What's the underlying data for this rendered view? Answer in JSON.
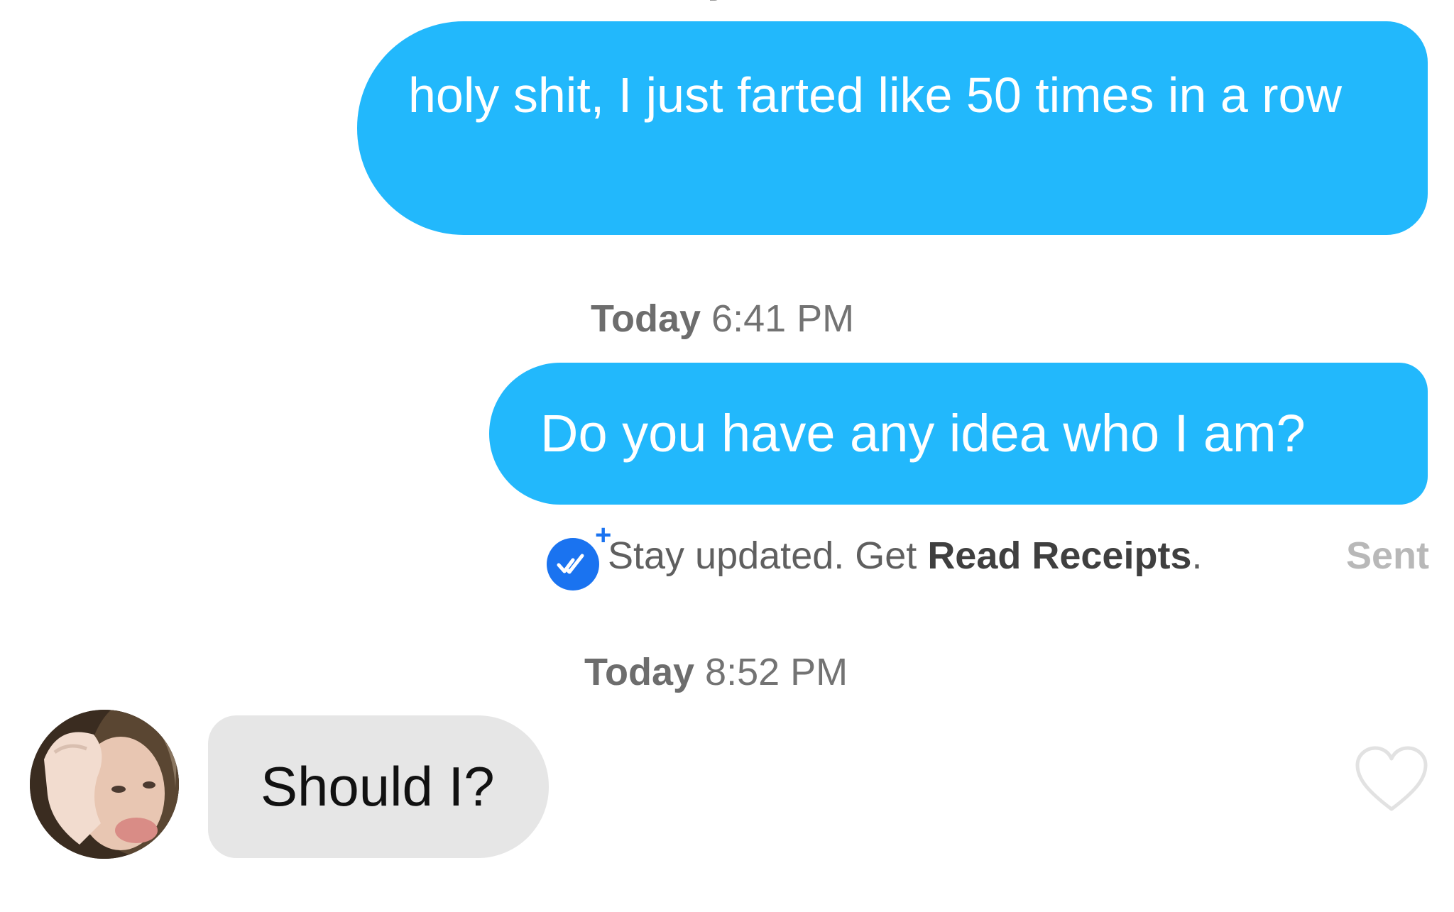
{
  "conversation": {
    "messages": [
      {
        "direction": "outgoing",
        "text": "holy shit, I just farted like 50 times in a row"
      },
      {
        "direction": "outgoing",
        "text": "Do you have any idea who I am?"
      },
      {
        "direction": "incoming",
        "text": "Should I?"
      }
    ],
    "timestamps": [
      {
        "day": "Today",
        "time": "6:41 PM"
      },
      {
        "day": "Today",
        "time": "8:52 PM"
      }
    ],
    "read_receipt_prompt": {
      "prefix": "Stay updated. Get ",
      "link": "Read Receipts",
      "suffix": ".",
      "icon": "double-check-badge-icon",
      "plus": "+"
    },
    "status": "Sent",
    "like_icon": "heart-outline-icon"
  },
  "colors": {
    "outgoing_bubble": "#22b8fc",
    "incoming_bubble": "#e6e6e6",
    "receipt_icon": "#1a73f0",
    "heart_outline": "#e2e2e2"
  }
}
